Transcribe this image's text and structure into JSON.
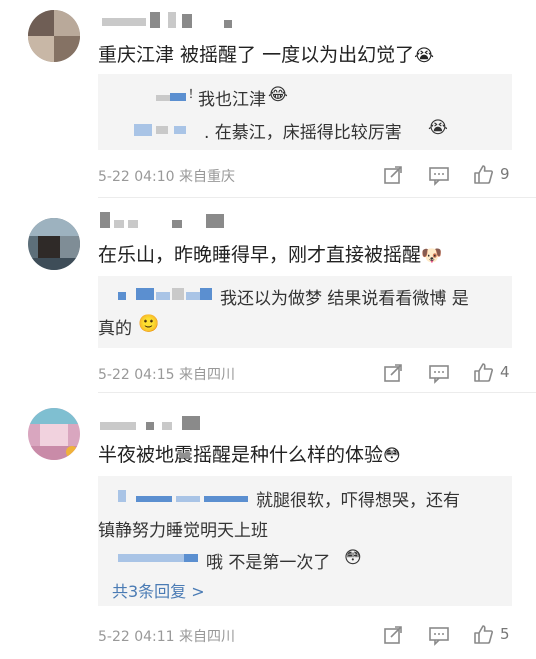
{
  "comments": [
    {
      "text": "重庆江津 被摇醒了 一度以为出幻觉了",
      "emoji": "😭",
      "replies": [
        {
          "text": "我也江津",
          "emoji": "😂",
          "prefix": "！"
        },
        {
          "text": ". 在綦江，床摇得比较厉害",
          "emoji": "😭"
        }
      ],
      "meta": "5-22 04:10  来自重庆",
      "likes": "9"
    },
    {
      "text": "在乐山，昨晚睡得早，刚才直接被摇醒",
      "emoji": "🐶",
      "replies": [
        {
          "text": "我还以为做梦 结果说看看微博 是",
          "text2": "真的",
          "emoji": "🙂"
        }
      ],
      "meta": "5-22 04:15  来自四川",
      "likes": "4"
    },
    {
      "text": "半夜被地震摇醒是种什么样的体验",
      "emoji": "😳",
      "replies": [
        {
          "text": "就腿很软，吓得想哭，还有",
          "text2": "镇静努力睡觉明天上班"
        },
        {
          "text": "哦 不是第一次了",
          "emoji": "😳"
        }
      ],
      "more": "共3条回复 >",
      "meta": "5-22 04:11  来自四川",
      "likes": "5"
    }
  ],
  "icons": [
    "share-icon",
    "comment-icon",
    "like-icon"
  ]
}
